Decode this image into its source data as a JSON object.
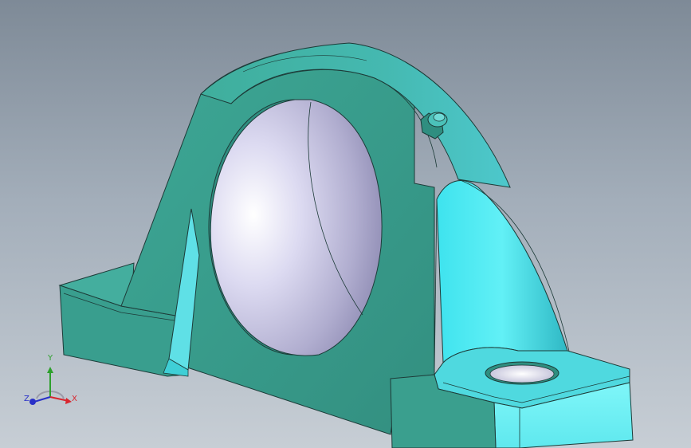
{
  "triad": {
    "x_label": "X",
    "y_label": "Y",
    "z_label": "Z",
    "x_color": "#d8262e",
    "y_color": "#2da02d",
    "z_color": "#2930c8"
  },
  "model": {
    "body_color": "#3aa592",
    "bore_color": "#dcdbf0",
    "fitting_icon": "grease-nipple-icon"
  }
}
